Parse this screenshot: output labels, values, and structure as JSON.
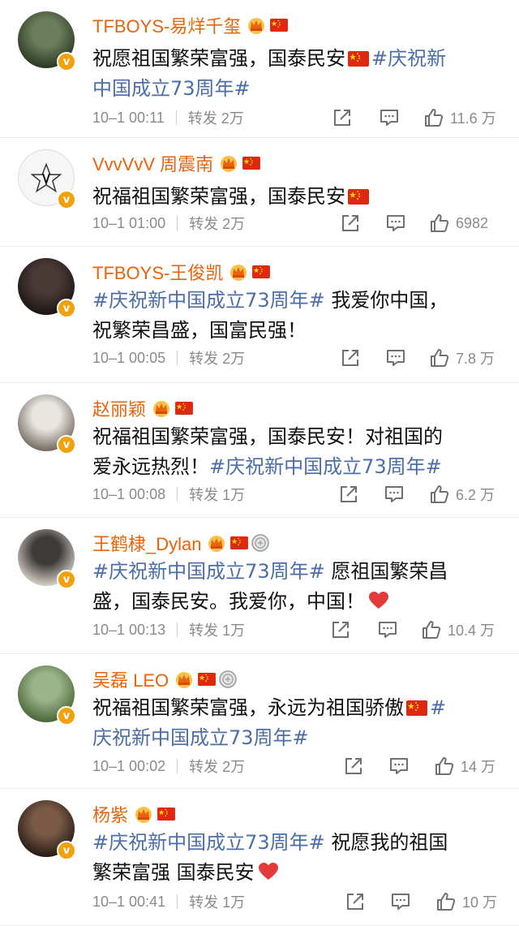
{
  "colors": {
    "name": "#e8630a",
    "hashtag": "#4c6ea8",
    "meta": "#8a8a8a",
    "vip_badge": "#f2a10c",
    "heart": "#e33a3a"
  },
  "posts": [
    {
      "name": "TFBOYS-易烊千玺",
      "badges": [
        "crown-icon",
        "china-flag-icon"
      ],
      "lines": [
        [
          {
            "t": "text",
            "v": "祝愿祖国繁荣富强，国泰民安"
          },
          {
            "t": "flag"
          },
          {
            "t": "tag",
            "v": "#庆祝新"
          }
        ],
        [
          {
            "t": "tag",
            "v": "中国成立73周年#"
          }
        ]
      ],
      "time": "10–1 00:11",
      "repost": "转发 2万",
      "likes": "11.6 万"
    },
    {
      "name": "VvvVvV 周震南",
      "badges": [
        "crown-icon",
        "china-flag-icon"
      ],
      "lines": [
        [
          {
            "t": "text",
            "v": "祝福祖国繁荣富强，国泰民安"
          },
          {
            "t": "flag"
          }
        ]
      ],
      "time": "10–1 01:00",
      "repost": "转发 2万",
      "likes": "6982"
    },
    {
      "name": "TFBOYS-王俊凯",
      "badges": [
        "crown-icon",
        "china-flag-icon"
      ],
      "lines": [
        [
          {
            "t": "tag",
            "v": "#庆祝新中国成立73周年#"
          },
          {
            "t": "text",
            "v": " 我爱你中国，"
          }
        ],
        [
          {
            "t": "text",
            "v": "祝繁荣昌盛，国富民强！"
          }
        ]
      ],
      "time": "10–1 00:05",
      "repost": "转发 2万",
      "likes": "7.8 万"
    },
    {
      "name": "赵丽颖",
      "badges": [
        "crown-icon",
        "china-flag-icon"
      ],
      "lines": [
        [
          {
            "t": "text",
            "v": "祝福祖国繁荣富强，国泰民安！对祖国的"
          }
        ],
        [
          {
            "t": "text",
            "v": "爱永远热烈！"
          },
          {
            "t": "tag",
            "v": "#庆祝新中国成立73周年#"
          }
        ]
      ],
      "time": "10–1 00:08",
      "repost": "转发 1万",
      "likes": "6.2 万"
    },
    {
      "name": "王鹤棣_Dylan",
      "badges": [
        "crown-icon",
        "china-flag-icon",
        "medal-icon"
      ],
      "lines": [
        [
          {
            "t": "tag",
            "v": "#庆祝新中国成立73周年#"
          },
          {
            "t": "text",
            "v": " 愿祖国繁荣昌"
          }
        ],
        [
          {
            "t": "text",
            "v": "盛，国泰民安。我爱你，中国！"
          },
          {
            "t": "heart"
          }
        ]
      ],
      "time": "10–1 00:13",
      "repost": "转发 1万",
      "likes": "10.4 万"
    },
    {
      "name": "吴磊 LEO",
      "badges": [
        "crown-icon",
        "china-flag-icon",
        "medal-icon"
      ],
      "lines": [
        [
          {
            "t": "text",
            "v": "祝福祖国繁荣富强，永远为祖国骄傲"
          },
          {
            "t": "flag"
          },
          {
            "t": "tag",
            "v": "#"
          }
        ],
        [
          {
            "t": "tag",
            "v": "庆祝新中国成立73周年#"
          }
        ]
      ],
      "time": "10–1 00:02",
      "repost": "转发 2万",
      "likes": "14 万"
    },
    {
      "name": "杨紫",
      "badges": [
        "crown-icon",
        "china-flag-icon"
      ],
      "lines": [
        [
          {
            "t": "tag",
            "v": "#庆祝新中国成立73周年#"
          },
          {
            "t": "text",
            "v": " 祝愿我的祖国"
          }
        ],
        [
          {
            "t": "text",
            "v": "繁荣富强 国泰民安"
          },
          {
            "t": "heart"
          }
        ]
      ],
      "time": "10–1 00:41",
      "repost": "转发 1万",
      "likes": "10 万"
    }
  ]
}
